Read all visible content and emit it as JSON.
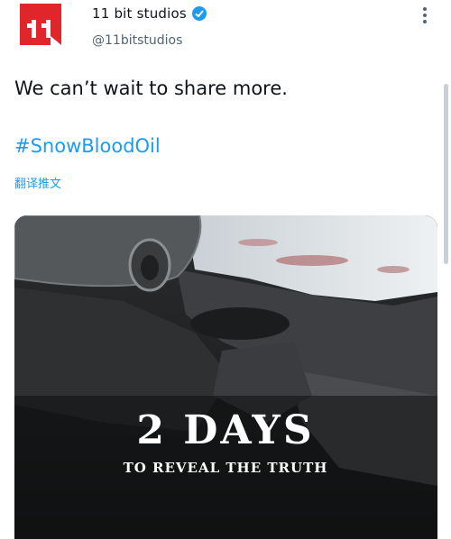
{
  "account": {
    "name": "11 bit studios",
    "handle": "@11bitstudios",
    "verified": true,
    "avatar_color": "#e0262a"
  },
  "tweet": {
    "text": "We can’t wait to share more.",
    "hashtag": "#SnowBloodOil",
    "translate_label": "翻译推文"
  },
  "media": {
    "headline": "2 DAYS",
    "subline": "TO REVEAL THE TRUTH"
  },
  "icons": {
    "verified": "verified-badge-icon",
    "more": "more-options-icon"
  },
  "colors": {
    "link": "#1d9bf0",
    "text": "#0f1419",
    "secondary": "#536471"
  }
}
